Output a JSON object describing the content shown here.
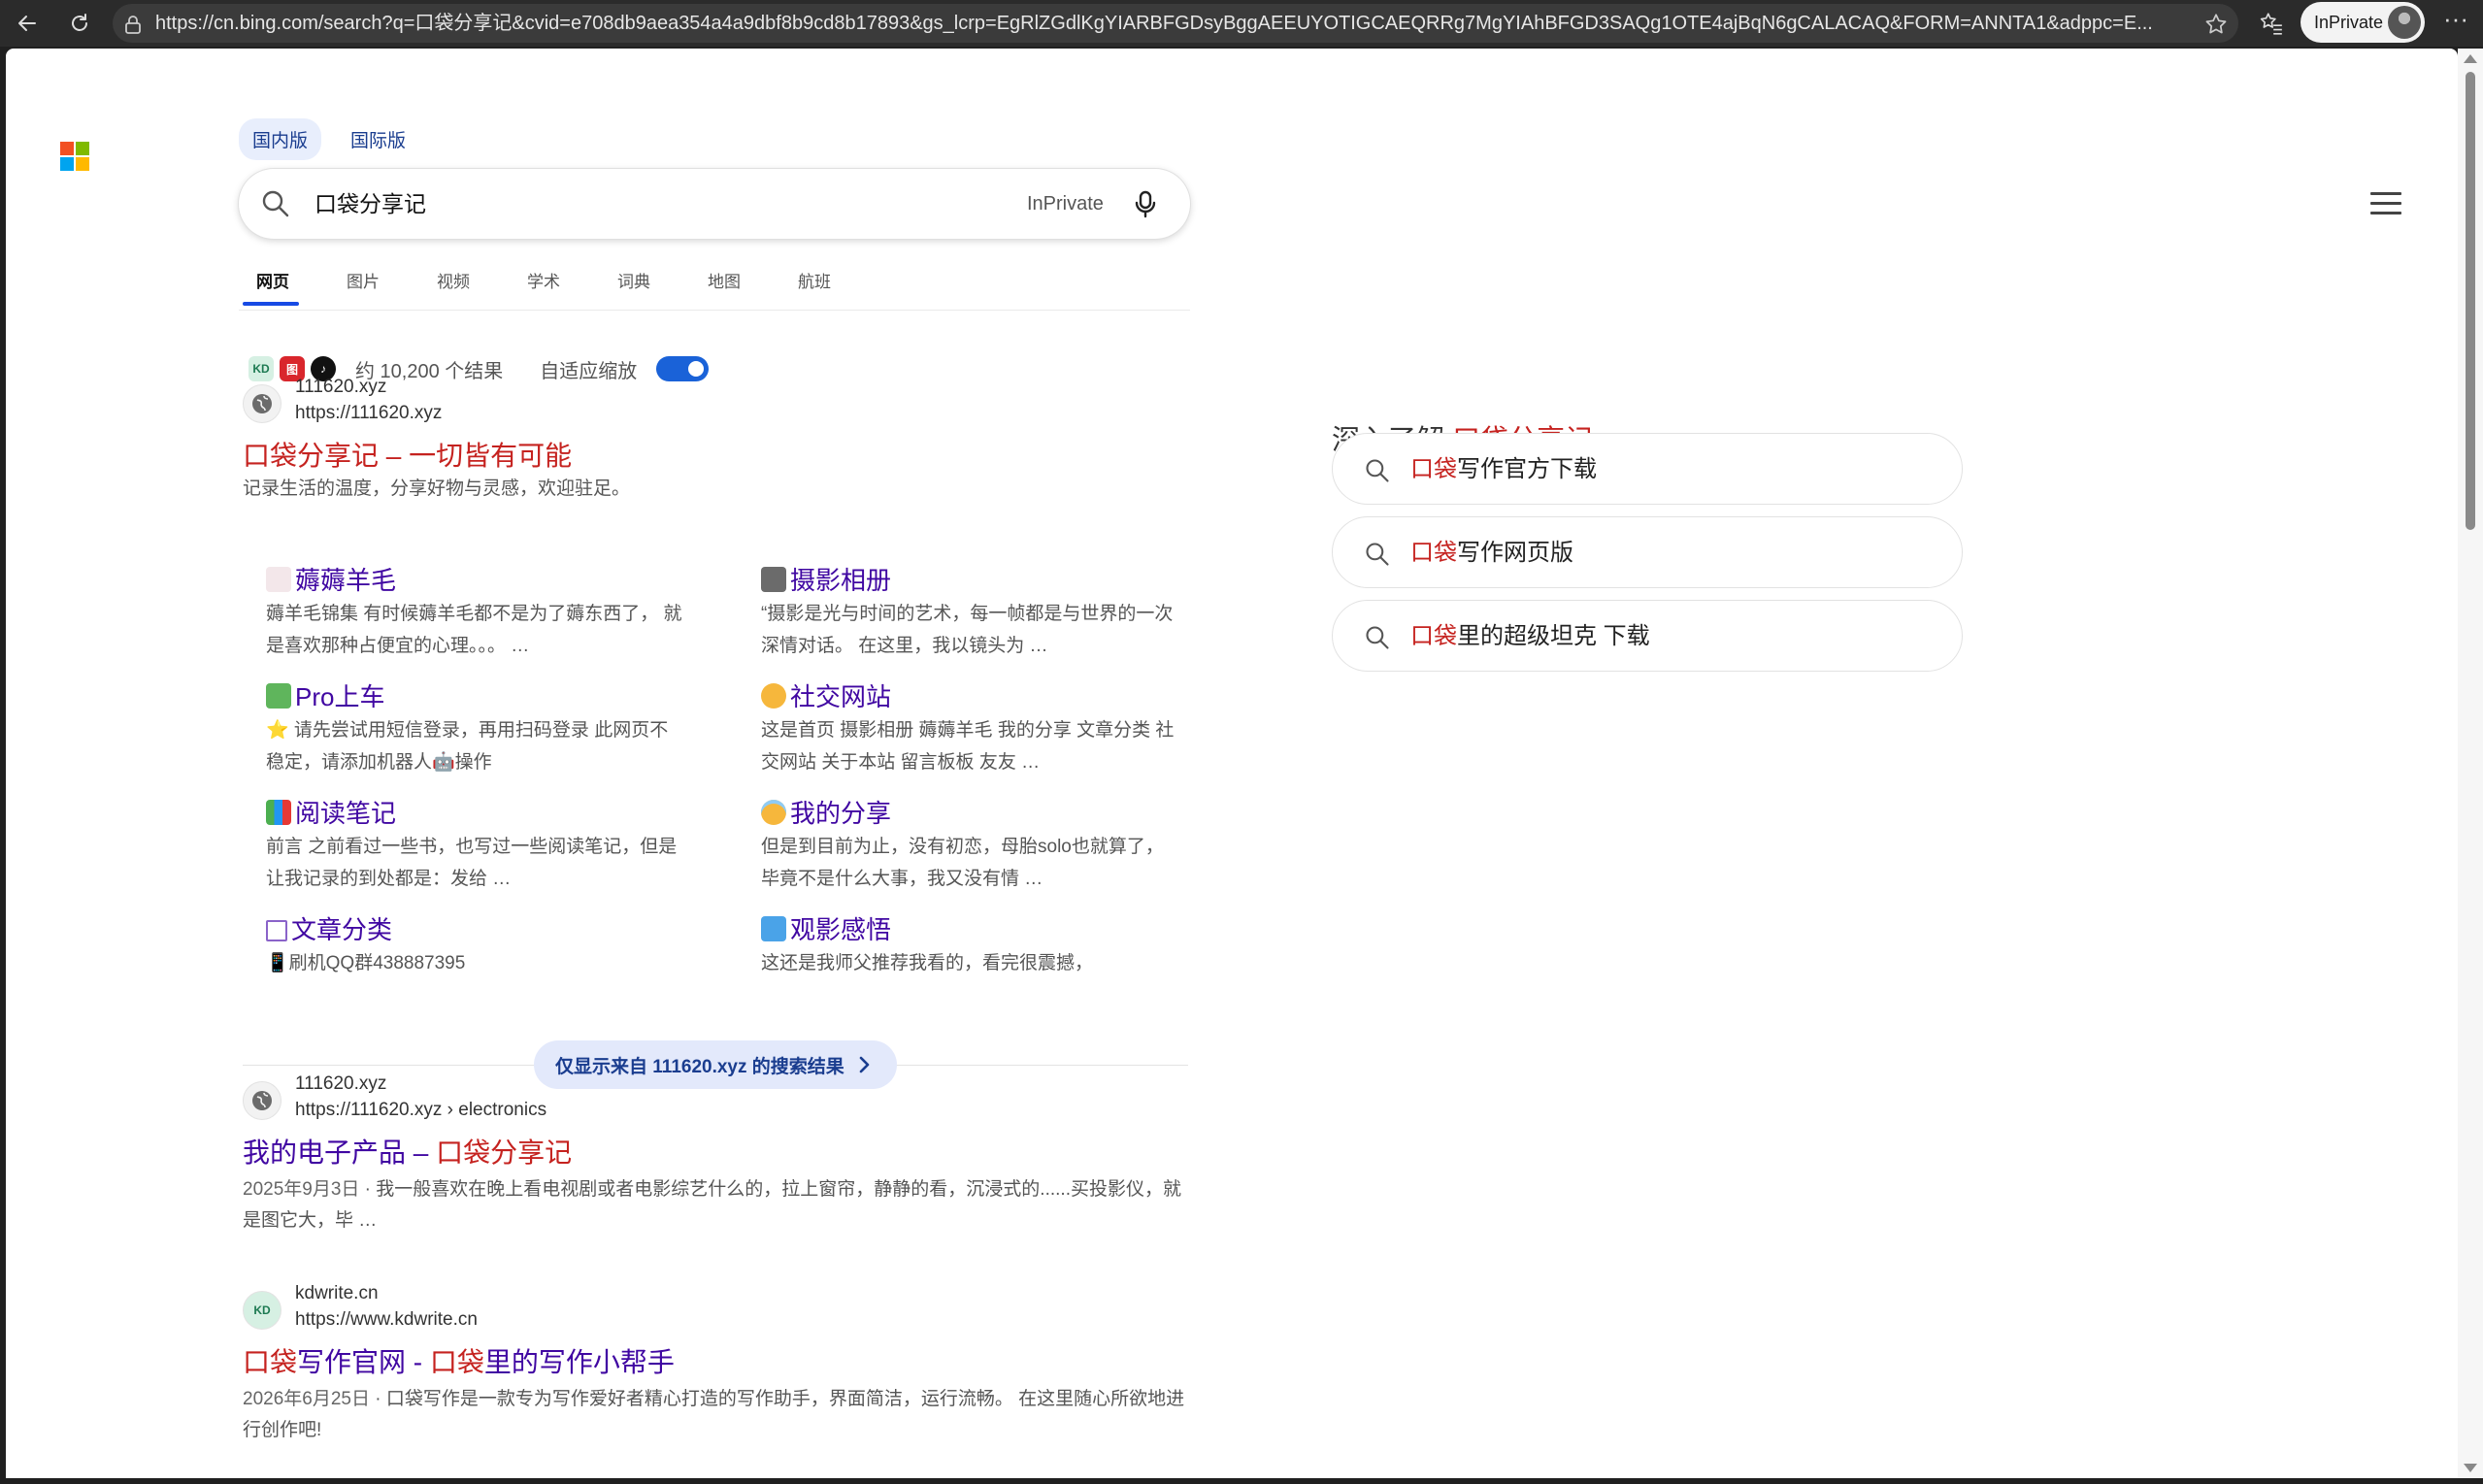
{
  "browser": {
    "url": "https://cn.bing.com/search?q=口袋分享记&cvid=e708db9aea354a4a9dbf8b9cd8b17893&gs_lcrp=EgRlZGdlKgYIARBFGDsyBggAEEUYOTIGCAEQRRg7MgYIAhBFGD3SAQg1OTE4ajBqN6gCALACAQ&FORM=ANNTA1&adppc=E...",
    "profile_label": "InPrivate",
    "more_label": "···"
  },
  "header": {
    "region_tabs": [
      "国内版",
      "国际版"
    ],
    "search_query": "口袋分享记",
    "inprivate_label": "InPrivate",
    "scopes": [
      "网页",
      "图片",
      "视频",
      "学术",
      "词典",
      "地图",
      "航班"
    ]
  },
  "info_row": {
    "favicon_labels": [
      "KD",
      "图",
      "♪"
    ],
    "result_count": "约 10,200 个结果",
    "adaptive_zoom_label": "自适应缩放",
    "adaptive_zoom_on": true
  },
  "results": [
    {
      "site": "111620.xyz",
      "url": "https://111620.xyz",
      "title": "口袋分享记 – 一切皆有可能",
      "snippet": "记录生活的温度，分享好物与灵感，欢迎驻足。"
    },
    {
      "site": "111620.xyz",
      "url": "https://111620.xyz › electronics",
      "title_plain": "我的电子产品 – ",
      "title_hl": "口袋分享记",
      "date": "2025年9月3日",
      "snippet": "我一般喜欢在晚上看电视剧或者电影综艺什么的，拉上窗帘，静静的看，沉浸式的......买投影仪，就是图它大，毕 …"
    },
    {
      "site": "kdwrite.cn",
      "url": "https://www.kdwrite.cn",
      "title_hl1": "口袋",
      "title_plain1": "写作官网 - ",
      "title_hl2": "口袋",
      "title_plain2": "里的写作小帮手",
      "date": "2026年6月25日",
      "snippet": "口袋写作是一款专为写作爱好者精心打造的写作助手，界面简洁，运行流畅。 在这里随心所欲地进行创作吧!"
    }
  ],
  "deeplinks": [
    {
      "emoji": "🐑",
      "title": "薅薅羊毛",
      "desc": "薅羊毛锦集 有时候薅羊毛都不是为了薅东西了， 就是喜欢那种占便宜的心理。。。 …"
    },
    {
      "emoji": "📷",
      "title": "摄影相册",
      "desc": "“摄影是光与时间的艺术，每一帧都是与世界的一次深情对话。 在这里，我以镜头为 …"
    },
    {
      "emoji": "🐉",
      "title": "Pro上车",
      "desc": "⭐ 请先尝试用短信登录，再用扫码登录 此网页不稳定，请添加机器人🤖操作"
    },
    {
      "emoji": "😁",
      "title": "社交网站",
      "desc": "这是首页 摄影相册 薅薅羊毛 我的分享 文章分类 社交网站 关于本站 留言板板 友友 …"
    },
    {
      "emoji": "📚",
      "title": "阅读笔记",
      "desc": "前言 之前看过一些书，也写过一些阅读笔记，但是让我记录的到处都是：发给 …"
    },
    {
      "emoji": "😇",
      "title": "我的分享",
      "desc": "但是到目前为止，没有初恋，母胎solo也就算了，毕竟不是什么大事，我又没有情 …"
    },
    {
      "emoji": "⬜",
      "title": "文章分类",
      "desc": "📱刷机QQ群438887395"
    },
    {
      "emoji": "🎦",
      "title": "观影感悟",
      "desc": "这还是我师父推荐我看的，看完很震撼，"
    }
  ],
  "site_filter": {
    "label": "仅显示来自 111620.xyz 的搜索结果"
  },
  "right_rail": {
    "title_prefix": "深入了解 ",
    "title_hl": "口袋分享记",
    "suggestions": [
      {
        "hl": "口袋",
        "rest": "写作官方下载"
      },
      {
        "hl": "口袋",
        "rest": "写作网页版"
      },
      {
        "hl": "口袋",
        "rest": "里的超级坦克 下载"
      }
    ]
  },
  "colors": {
    "link": "#4007a2",
    "highlight": "#c5221f",
    "accent": "#174ae4",
    "toggle_on": "#1a62d8"
  }
}
